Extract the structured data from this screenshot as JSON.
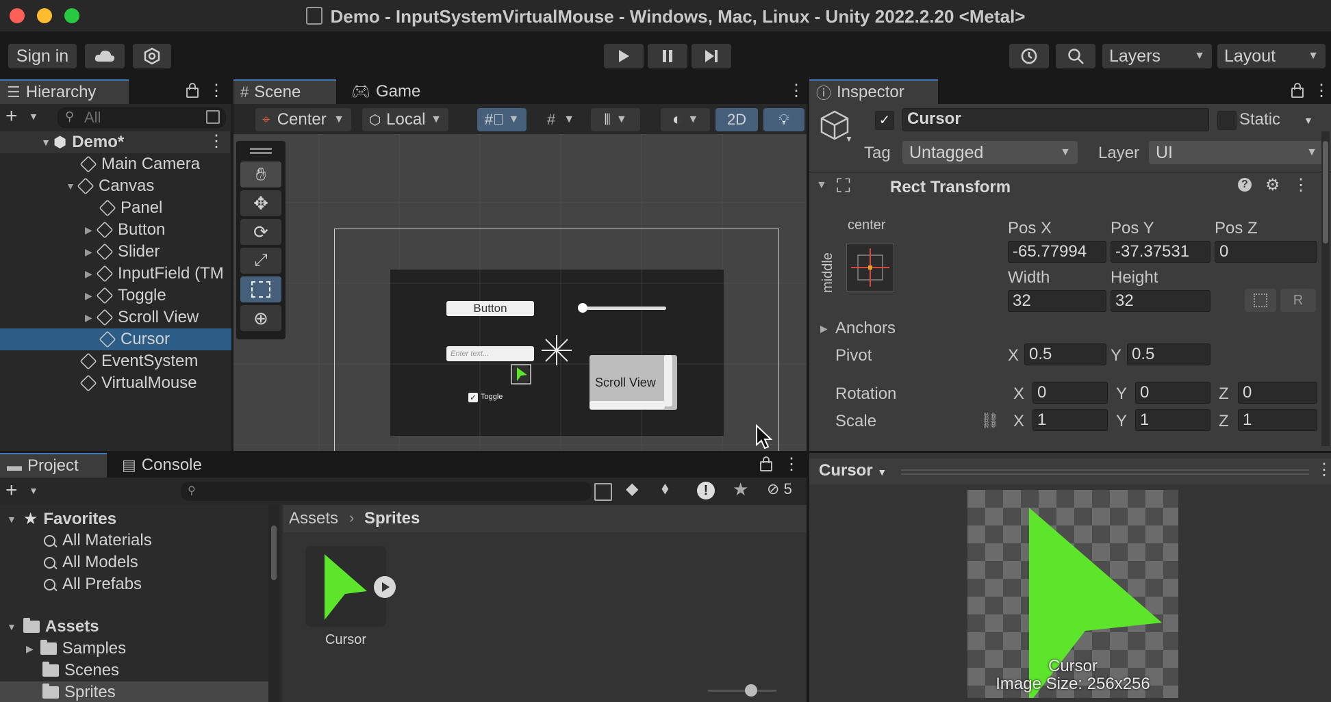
{
  "window": {
    "title": "Demo - InputSystemVirtualMouse - Windows, Mac, Linux - Unity 2022.2.20 <Metal>"
  },
  "toolbar": {
    "sign_in": "Sign in",
    "layers": "Layers",
    "layout": "Layout"
  },
  "hierarchy": {
    "tab": "Hierarchy",
    "search_placeholder": "All",
    "scene": "Demo*",
    "items": [
      "Main Camera",
      "Canvas",
      "Panel",
      "Button",
      "Slider",
      "InputField (TM",
      "Toggle",
      "Scroll View",
      "Cursor",
      "EventSystem",
      "VirtualMouse"
    ],
    "selected": "Cursor"
  },
  "scene": {
    "tab_scene": "Scene",
    "tab_game": "Game",
    "pivot_mode": "Center",
    "space_mode": "Local",
    "mode_2d": "2D",
    "ui": {
      "button": "Button",
      "input_placeholder": "Enter text...",
      "toggle": "Toggle",
      "scroll_view": "Scroll View"
    }
  },
  "inspector": {
    "tab": "Inspector",
    "object_name": "Cursor",
    "static_label": "Static",
    "tag_label": "Tag",
    "tag_value": "Untagged",
    "layer_label": "Layer",
    "layer_value": "UI",
    "rect_transform": {
      "title": "Rect Transform",
      "anchor_h": "center",
      "anchor_v": "middle",
      "pos_x_label": "Pos X",
      "pos_y_label": "Pos Y",
      "pos_z_label": "Pos Z",
      "pos_x": "-65.77994",
      "pos_y": "-37.37531",
      "pos_z": "0",
      "width_label": "Width",
      "height_label": "Height",
      "width": "32",
      "height": "32",
      "r_button": "R",
      "anchors": "Anchors",
      "pivot": "Pivot",
      "pivot_x": "0.5",
      "pivot_y": "0.5",
      "rotation": "Rotation",
      "rot_x": "0",
      "rot_y": "0",
      "rot_z": "0",
      "scale": "Scale",
      "scale_x": "1",
      "scale_y": "1",
      "scale_z": "1",
      "x": "X",
      "y": "Y",
      "z": "Z"
    }
  },
  "project": {
    "tab_project": "Project",
    "tab_console": "Console",
    "hidden_count": "5",
    "favorites": "Favorites",
    "favorite_items": [
      "All Materials",
      "All Models",
      "All Prefabs"
    ],
    "assets": "Assets",
    "asset_folders": [
      "Samples",
      "Scenes",
      "Sprites"
    ],
    "breadcrumb_root": "Assets",
    "breadcrumb_current": "Sprites",
    "asset_name": "Cursor"
  },
  "preview": {
    "title": "Cursor",
    "name": "Cursor",
    "image_size": "Image Size: 256x256"
  },
  "colors": {
    "accent": "#3a79bb",
    "selection": "#2c5d87",
    "cursor_green": "#5ce52b"
  }
}
